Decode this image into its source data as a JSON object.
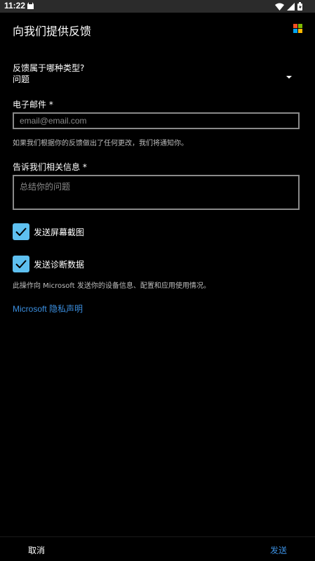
{
  "status_bar": {
    "time": "11:22",
    "icons": [
      "notification-icon",
      "wifi-icon",
      "signal-icon",
      "battery-icon"
    ]
  },
  "header": {
    "title": "向我们提供反馈",
    "logo": "microsoft-logo"
  },
  "feedback_type": {
    "label": "反馈属于哪种类型?",
    "value": "问题"
  },
  "email": {
    "label": "电子邮件 *",
    "placeholder": "email@email.com",
    "value": "",
    "helper": "如果我们根据你的反馈做出了任何更改，我们将通知你。"
  },
  "details": {
    "label": "告诉我们相关信息 *",
    "placeholder": "总结你的问题",
    "value": ""
  },
  "options": {
    "screenshot": {
      "label": "发送屏幕截图",
      "checked": true
    },
    "diagnostics": {
      "label": "发送诊断数据",
      "checked": true
    },
    "diagnostics_note": "此操作向 Microsoft 发送你的设备信息、配置和应用使用情况。"
  },
  "privacy_link": "Microsoft 隐私声明",
  "footer": {
    "cancel": "取消",
    "send": "发送"
  },
  "colors": {
    "accent": "#3b8fe0",
    "checkbox": "#5ec0f0",
    "background": "#000000"
  }
}
